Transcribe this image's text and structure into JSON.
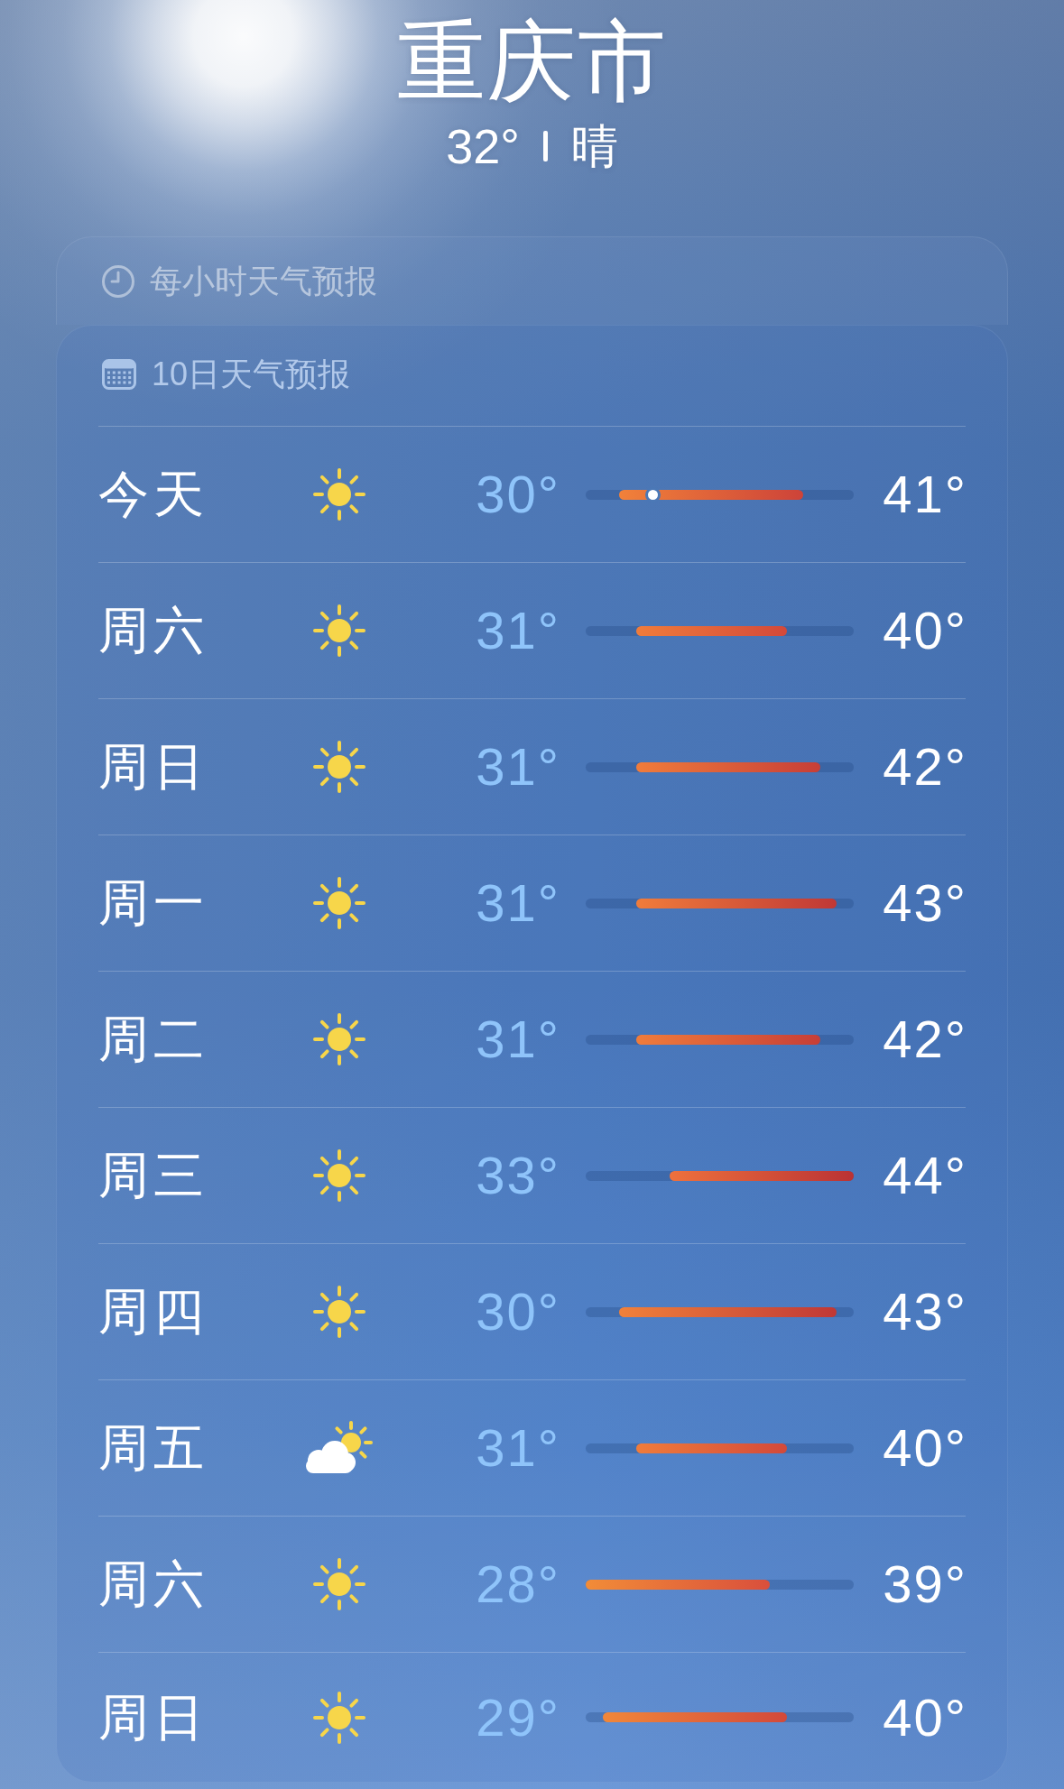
{
  "location": {
    "city": "重庆市",
    "temperature": "32°",
    "condition": "晴"
  },
  "hourly_forecast": {
    "title": "每小时天气预报"
  },
  "daily_forecast": {
    "title": "10日天气预报",
    "days": [
      {
        "day": "今天",
        "kind": "sunny",
        "low": "30°",
        "high": "41°",
        "current_marker": true
      },
      {
        "day": "周六",
        "kind": "sunny",
        "low": "31°",
        "high": "40°",
        "current_marker": false
      },
      {
        "day": "周日",
        "kind": "sunny",
        "low": "31°",
        "high": "42°",
        "current_marker": false
      },
      {
        "day": "周一",
        "kind": "sunny",
        "low": "31°",
        "high": "43°",
        "current_marker": false
      },
      {
        "day": "周二",
        "kind": "sunny",
        "low": "31°",
        "high": "42°",
        "current_marker": false
      },
      {
        "day": "周三",
        "kind": "sunny",
        "low": "33°",
        "high": "44°",
        "current_marker": false
      },
      {
        "day": "周四",
        "kind": "sunny",
        "low": "30°",
        "high": "43°",
        "current_marker": false
      },
      {
        "day": "周五",
        "kind": "cloudy",
        "low": "31°",
        "high": "40°",
        "current_marker": false
      },
      {
        "day": "周六",
        "kind": "sunny",
        "low": "28°",
        "high": "39°",
        "current_marker": false
      },
      {
        "day": "周日",
        "kind": "sunny",
        "low": "29°",
        "high": "40°",
        "current_marker": false
      }
    ]
  }
}
